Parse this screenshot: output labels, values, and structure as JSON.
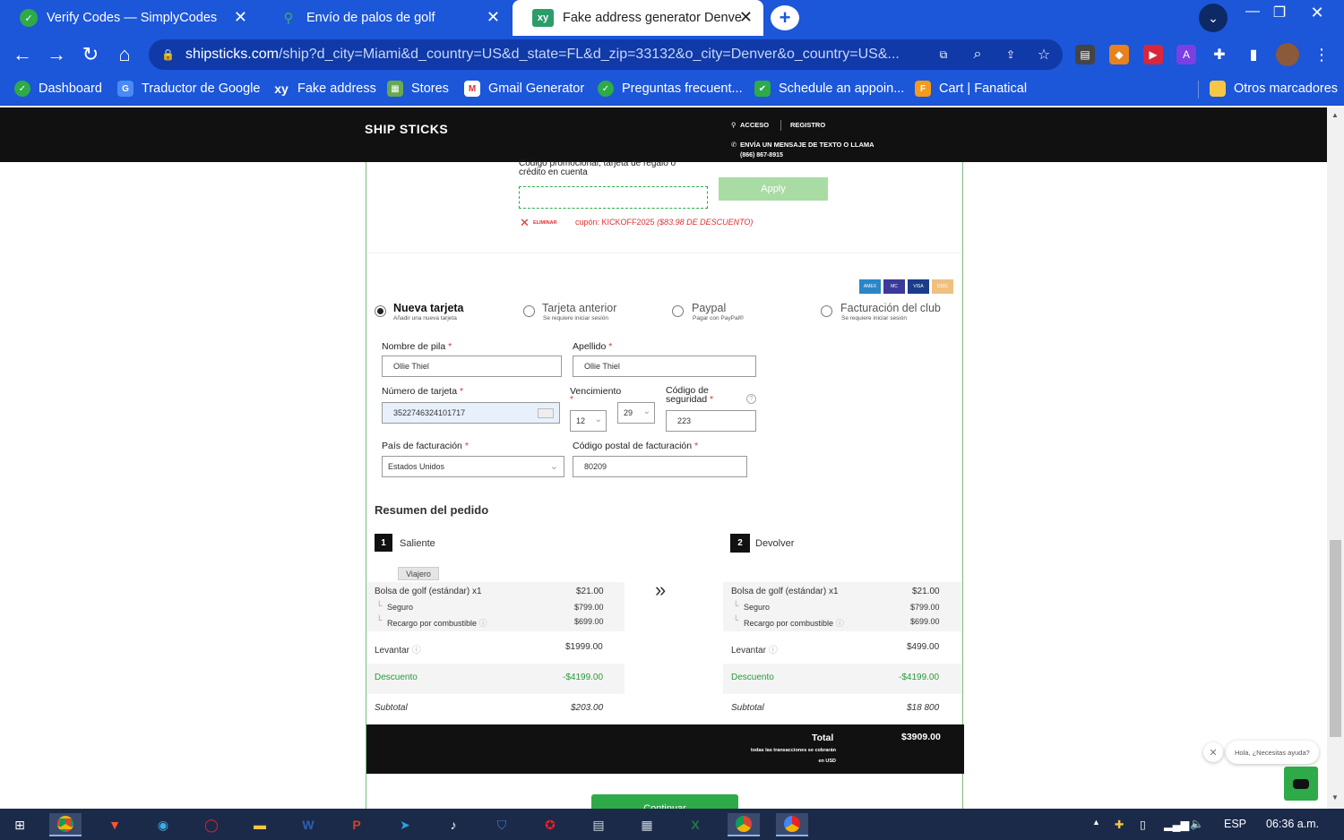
{
  "tabs": [
    {
      "title": "Verify Codes — SimplyCodes",
      "icon": "simplycodes-icon",
      "active": false
    },
    {
      "title": "Envío de palos de golf",
      "icon": "shipsticks-icon",
      "active": true
    },
    {
      "title": "Fake address generator Denver, C",
      "icon": "xy-icon",
      "active": false
    }
  ],
  "address_bar": {
    "host": "shipsticks.com",
    "path": "/ship?d_city=Miami&d_country=US&d_state=FL&d_zip=33132&o_city=Denver&o_country=US&..."
  },
  "bookmarks": [
    "Dashboard",
    "Traductor de Google",
    "Fake address",
    "Stores",
    "Gmail Generator",
    "Preguntas frecuent...",
    "Schedule an appoin...",
    "Cart | Fanatical"
  ],
  "other_bookmarks": "Otros marcadores",
  "site": {
    "logo": "SHIP STICKS",
    "login": "ACCESO",
    "register": "REGISTRO",
    "sms": "ENVÍA UN MENSAJE DE TEXTO O LLAMA",
    "phone": "(866) 867-8915"
  },
  "promo": {
    "label_line1": "Código promocional, tarjeta de regalo o",
    "label_line2": "crédito en cuenta",
    "input_value": "",
    "apply": "Apply",
    "remove": "ELIMINAR",
    "applied": "cupón: KICKOFF2025",
    "applied_detail": "($83.98 DE DESCUENTO)"
  },
  "payment_options": [
    {
      "title": "Nueva tarjeta",
      "subtitle": "Añadir una nueva tarjeta",
      "selected": true
    },
    {
      "title": "Tarjeta anterior",
      "subtitle": "Se requiere iniciar sesión",
      "selected": false
    },
    {
      "title": "Paypal",
      "subtitle": "Pagar con PayPal®",
      "selected": false
    },
    {
      "title": "Facturación del club",
      "subtitle": "Se requiere iniciar sesión",
      "selected": false
    }
  ],
  "card_brands": [
    "AMEX",
    "MC",
    "VISA",
    "DISC"
  ],
  "form": {
    "first_name_label": "Nombre de pila",
    "first_name": "Ollie Thiel",
    "last_name_label": "Apellido",
    "last_name": "Ollie Thiel",
    "card_number_label": "Número de tarjeta",
    "card_number": "3522746324101717",
    "expiry_label": "Vencimiento",
    "expiry_month": "12",
    "expiry_year": "29",
    "cvv_label_line1": "Código de",
    "cvv_label_line2": "seguridad",
    "cvv": "223",
    "country_label": "País de facturación",
    "country": "Estados Unidos",
    "zip_label": "Código postal de facturación",
    "zip": "80209",
    "required_mark": "*"
  },
  "summary": {
    "title": "Resumen del pedido",
    "outbound": {
      "step": "1",
      "label": "Saliente",
      "tag": "Viajero"
    },
    "return": {
      "step": "2",
      "label": "Devolver"
    },
    "outbound_rows": {
      "item": "Bolsa de golf (estándar) x1",
      "item_price": "$21.00",
      "insurance": "Seguro",
      "insurance_price": "$799.00",
      "fuel": "Recargo por combustible",
      "fuel_price": "$699.00",
      "pickup": "Levantar",
      "pickup_price": "$1999.00",
      "discount": "Descuento",
      "discount_price": "-$4199.00",
      "subtotal": "Subtotal",
      "subtotal_price": "$203.00"
    },
    "return_rows": {
      "item": "Bolsa de golf (estándar) x1",
      "item_price": "$21.00",
      "insurance": "Seguro",
      "insurance_price": "$799.00",
      "fuel": "Recargo por combustible",
      "fuel_price": "$699.00",
      "pickup": "Levantar",
      "pickup_price": "$499.00",
      "discount": "Descuento",
      "discount_price": "-$4199.00",
      "subtotal": "Subtotal",
      "subtotal_price": "$18 800"
    },
    "total_label": "Total",
    "total_note_line1": "todas las transacciones se cobrarán",
    "total_note_line2": "en USD",
    "total": "$3909.00",
    "continue": "Continuar"
  },
  "chat": {
    "bubble": "Hola, ¿Necesitas ayuda?"
  },
  "taskbar": {
    "lang": "ESP",
    "time": "06:36 a.m."
  },
  "colors": {
    "chrome_blue": "#1c56d9",
    "accent_green": "#2eaa49",
    "site_dark": "#111111",
    "error_red": "#e03030"
  }
}
